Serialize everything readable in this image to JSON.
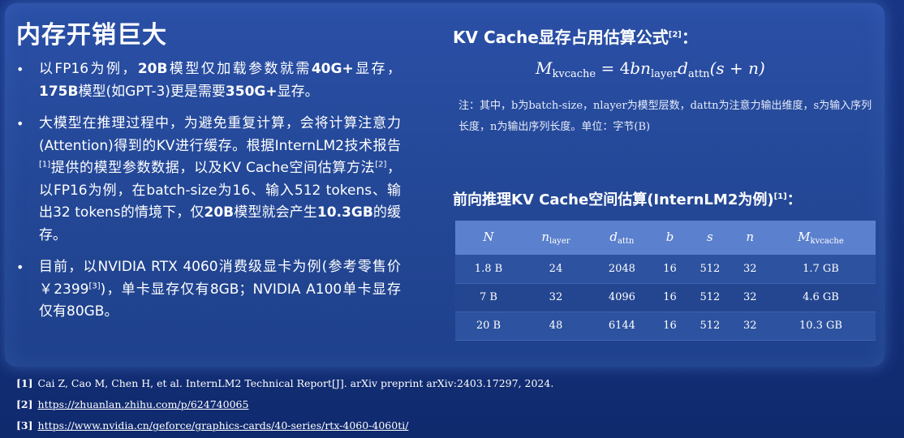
{
  "left": {
    "title": "内存开销巨大",
    "b1": {
      "p1": "以FP16为例，",
      "bold1": "20B",
      "p2": "模型仅加载参数就需",
      "bold2": "40G+",
      "p3": "显存，",
      "bold3": "175B",
      "p4": "模型(如GPT-3)更是需要",
      "bold4": "350G+",
      "p5": "显存。"
    },
    "b2": {
      "p1": "大模型在推理过程中，为避免重复计算，会将计算注意力(Attention)得到的KV进行缓存。根据InternLM2技术报告",
      "sup1": "[1]",
      "p2": "提供的模型参数数据，以及KV Cache空间估算方法",
      "sup2": "[2]",
      "p3": "，以FP16为例，在batch-size为16、输入512 tokens、输出32 tokens的情境下，仅",
      "bold1": "20B",
      "p4": "模型就会产生",
      "bold2": "10.3GB",
      "p5": "的缓存。"
    },
    "b3": {
      "p1": "目前，以NVIDIA RTX 4060消费级显卡为例(参考零售价￥2399",
      "sup1": "[3]",
      "p2": ")，单卡显存仅有8GB；NVIDIA A100单卡显存仅有80GB。"
    }
  },
  "right": {
    "heading1": "KV Cache显存占用估算公式",
    "heading1_sup": "[2]",
    "heading1_colon": "：",
    "formula": {
      "lhs": "M",
      "lhs_sub": "kvcache",
      "eq": " = 4",
      "b": "b",
      "n1": "n",
      "n1_sub": "layer",
      "d": "d",
      "d_sub": "attn",
      "tail": "(s + n)"
    },
    "note": "注：其中，b为batch-size，nlayer为模型层数，dattn为注意力输出维度，s为输入序列长度，n为输出序列长度。单位：字节(B)",
    "heading2": "前向推理KV Cache空间估算(InternLM2为例)",
    "heading2_sup": "[1]",
    "heading2_colon": "：",
    "table": {
      "headers": [
        "N",
        "n",
        "d",
        "b",
        "s",
        "n",
        "M"
      ],
      "header_subs": [
        "",
        "layer",
        "attn",
        "",
        "",
        "",
        "kvcache"
      ],
      "rows": [
        [
          "1.8 B",
          "24",
          "2048",
          "16",
          "512",
          "32",
          "1.7 GB"
        ],
        [
          "7 B",
          "32",
          "4096",
          "16",
          "512",
          "32",
          "4.6 GB"
        ],
        [
          "20 B",
          "48",
          "6144",
          "16",
          "512",
          "32",
          "10.3 GB"
        ]
      ]
    }
  },
  "refs": [
    {
      "tag": "[1]",
      "text": "Cai Z, Cao M, Chen H, et al. InternLM2 Technical Report[J]. arXiv preprint arXiv:2403.17297, 2024."
    },
    {
      "tag": "[2]",
      "text": "https://zhuanlan.zhihu.com/p/624740065"
    },
    {
      "tag": "[3]",
      "text": "https://www.nvidia.cn/geforce/graphics-cards/40-series/rtx-4060-4060ti/"
    }
  ],
  "colors": {
    "background": "#15307a",
    "panel": "#244897",
    "table_header": "#5b80cd",
    "text": "#ffffff"
  }
}
